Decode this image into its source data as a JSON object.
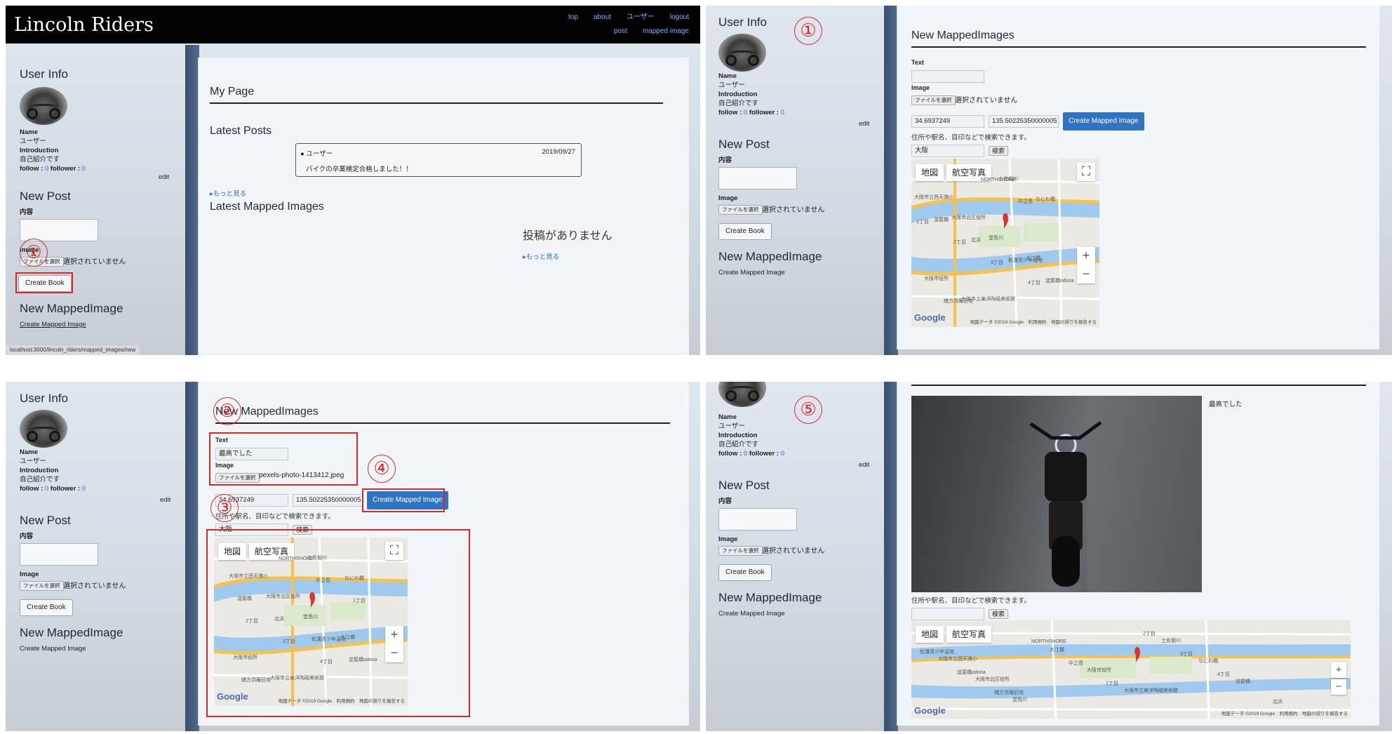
{
  "header": {
    "logo": "Lincoln Riders",
    "nav": [
      "top",
      "about",
      "ユーザー",
      "logout",
      "post",
      "mapped image"
    ]
  },
  "user": {
    "heading": "User Info",
    "name_label": "Name",
    "name_value": "ユーザー",
    "intro_label": "Introduction",
    "intro_value": "自己紹介です",
    "follow_label": "follow :",
    "follow_count": "0",
    "follower_label": "follower :",
    "follower_count": "0",
    "edit": "edit"
  },
  "new_post": {
    "heading": "New Post",
    "content_label": "内容",
    "image_label": "Image",
    "file_button": "ファイルを選択",
    "file_status": "選択されていません",
    "create_button": "Create Book"
  },
  "new_mapped": {
    "heading": "New MappedImage",
    "link": "Create Mapped Image"
  },
  "mypage": {
    "title": "My Page",
    "latest_posts": "Latest Posts",
    "post_user": "ユーザー",
    "post_date": "2019/09/27",
    "post_text": "バイクの卒業検定合格しました！！",
    "more1": "もっと見る",
    "latest_mapped": "Latest Mapped Images",
    "no_posts": "投稿がありません",
    "more2": "もっと見る"
  },
  "status_url": "localhost:3000/lincoln_riders/mapped_images/new",
  "form": {
    "title": "New MappedImages",
    "text_label": "Text",
    "text_value": "最高でした",
    "image_label": "Image",
    "file_button": "ファイルを選択",
    "file_status": "選択されていません",
    "file_name": "pexels-photo-1413412.jpeg",
    "lat": "34.6937249",
    "lng": "135.50225350000005",
    "submit": "Create Mapped Image",
    "search_hint": "住所や駅名、目印などで検索できます。",
    "search_value": "大阪",
    "search_button": "検索"
  },
  "map": {
    "tab_map": "地図",
    "tab_satellite": "航空写真",
    "google": "Google",
    "footer": "地図データ ©2019 Google　利用規約　地図の誤りを報告する",
    "labels": [
      "大阪市立西天満小",
      "大阪市北区役所",
      "堂島川",
      "大江橋",
      "大阪市役所",
      "大阪市立東洋陶磁美術館",
      "土佐堀川",
      "なにわ橋",
      "淀屋橋",
      "北浜",
      "松溝青少年温地",
      "淀屋橋odona",
      "緒方洪庵旧宅",
      "NORTHSHORE",
      "中之島",
      "1丁目",
      "2丁目",
      "3丁目",
      "4丁目"
    ],
    "zoom_in": "+",
    "zoom_out": "−"
  },
  "detail": {
    "caption": "最高でした",
    "search_hint": "住所や駅名、目印などで検索できます。",
    "search_button": "検索"
  },
  "annotations": [
    "①",
    "②",
    "③",
    "④",
    "⑤"
  ]
}
